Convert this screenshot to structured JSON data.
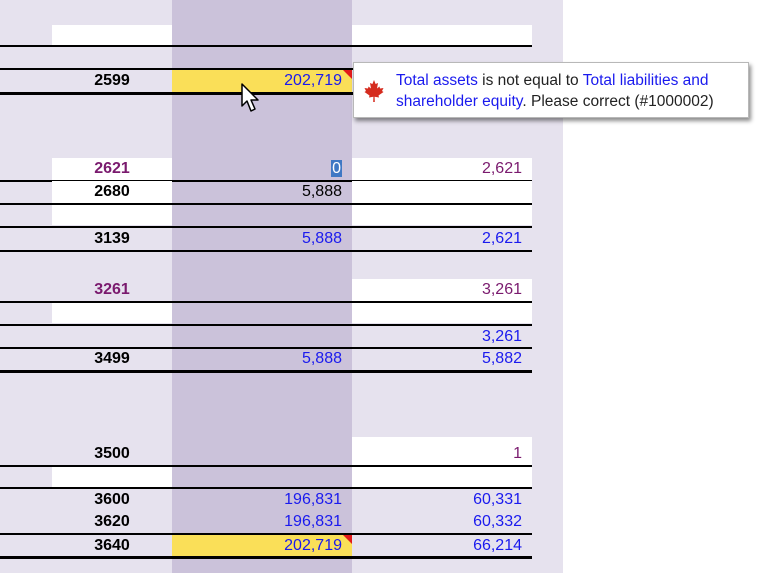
{
  "rows": [
    {
      "code": "",
      "val1": "",
      "val2": ""
    },
    {
      "code": "2599",
      "val1": "202,719",
      "val2": ""
    },
    {
      "code": "2621",
      "val1": "0",
      "val2": "2,621"
    },
    {
      "code": "2680",
      "val1": "5,888",
      "val2": ""
    },
    {
      "code": "3139",
      "val1": "5,888",
      "val2": "2,621"
    },
    {
      "code": "3261",
      "val1": "",
      "val2": "3,261"
    },
    {
      "code": "",
      "val1": "",
      "val2": "3,261"
    },
    {
      "code": "3499",
      "val1": "5,888",
      "val2": "5,882"
    },
    {
      "code": "3500",
      "val1": "",
      "val2": "1"
    },
    {
      "code": "3600",
      "val1": "196,831",
      "val2": "60,331"
    },
    {
      "code": "3620",
      "val1": "196,831",
      "val2": "60,332"
    },
    {
      "code": "3640",
      "val1": "202,719",
      "val2": "66,214"
    }
  ],
  "tooltip": {
    "part1_link": "Total assets",
    "part2": " is not equal to ",
    "part3_link": "Total liabilities and shareholder equity",
    "part4": ". Please correct (#1000002)",
    "icon": "maple-leaf-icon"
  },
  "colors": {
    "panel": "#e6e2ee",
    "column_band": "#cbc2da",
    "highlight": "#fadf58",
    "error_flag": "#e21b1b",
    "link_blue": "#1a1aee",
    "code_purple": "#7a1a6e"
  }
}
